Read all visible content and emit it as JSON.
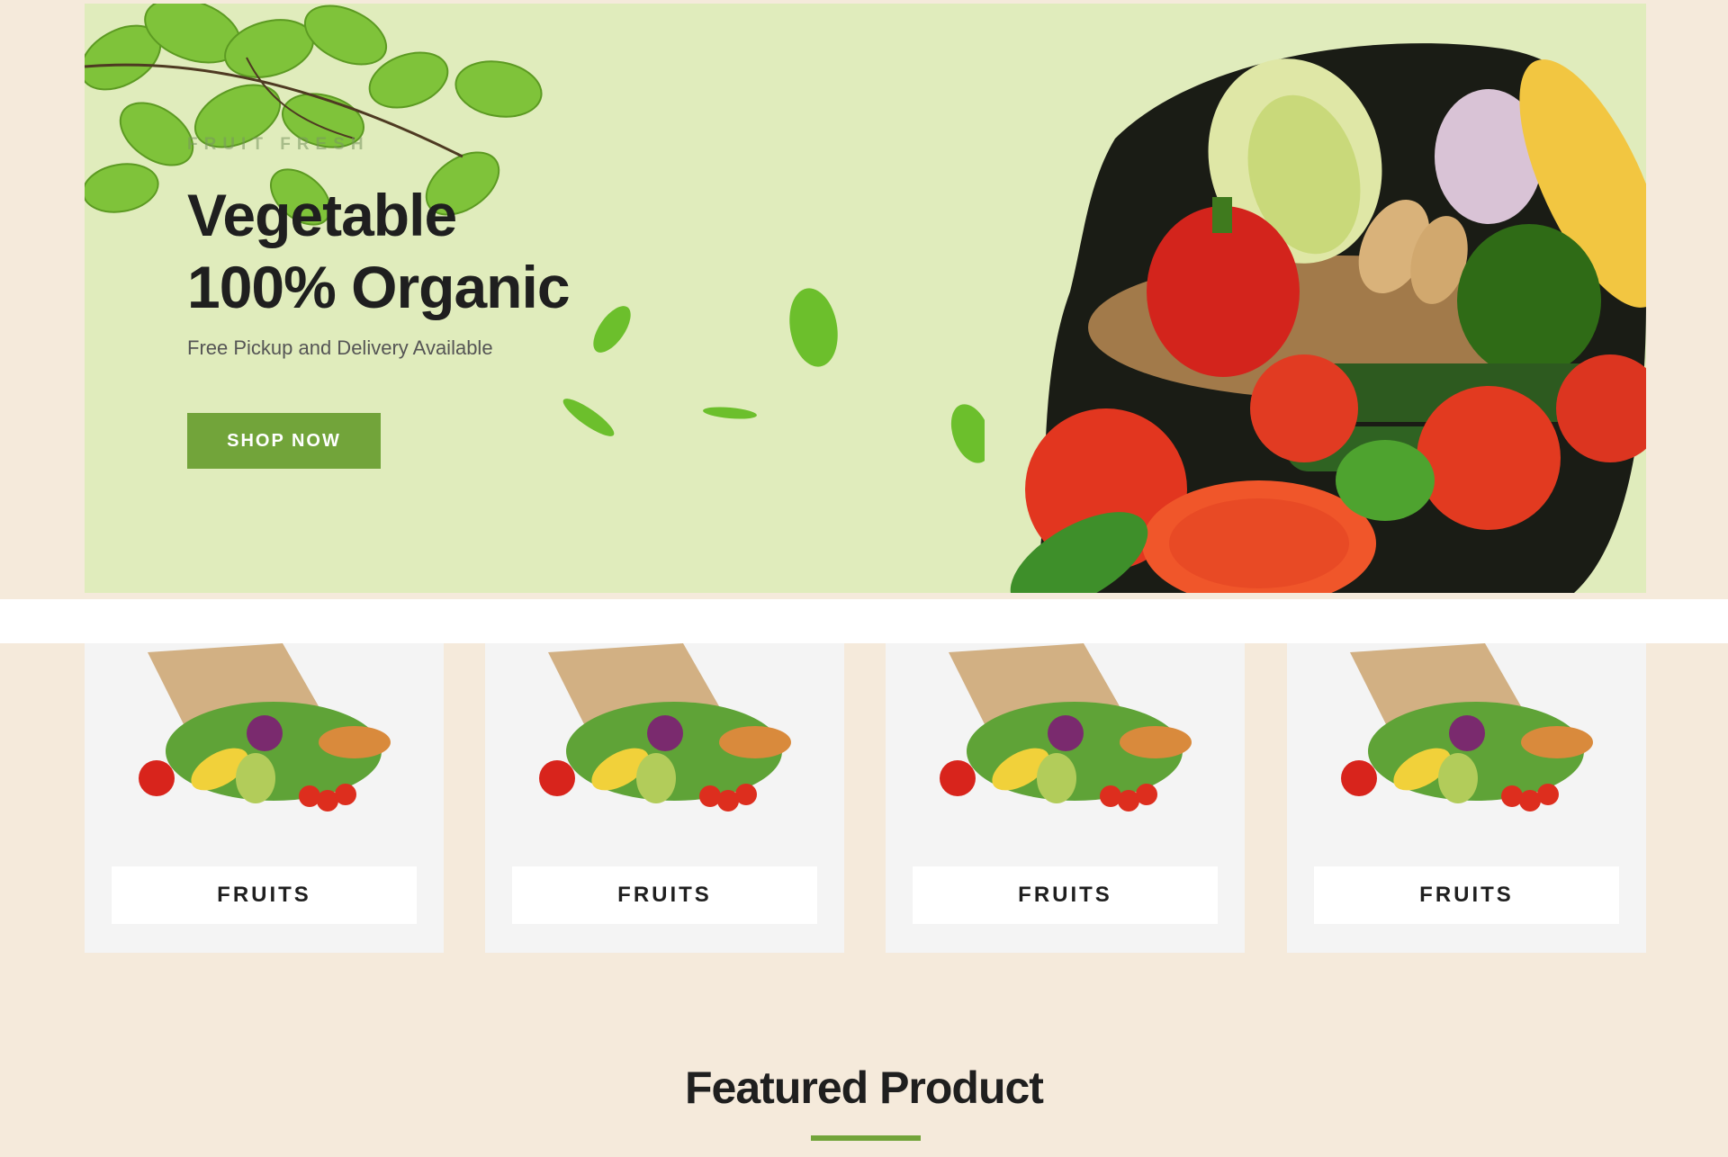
{
  "hero": {
    "kicker": "Fruit Fresh",
    "title_line1": "Vegetable",
    "title_line2": "100% Organic",
    "subtitle": "Free Pickup and Delivery Available",
    "cta_label": "SHOP NOW",
    "background_color": "#e0ecbc",
    "accent_color": "#72a43a"
  },
  "categories": [
    {
      "label": "FRUITS",
      "image_icon": "grocery-bag-icon"
    },
    {
      "label": "FRUITS",
      "image_icon": "grocery-bag-icon"
    },
    {
      "label": "FRUITS",
      "image_icon": "grocery-bag-icon"
    },
    {
      "label": "FRUITS",
      "image_icon": "grocery-bag-icon"
    }
  ],
  "featured": {
    "title": "Featured Product"
  },
  "colors": {
    "page_background": "#f5eadb",
    "card_background": "#f4f4f4",
    "accent": "#72a43a",
    "text_dark": "#1f1f1f"
  }
}
